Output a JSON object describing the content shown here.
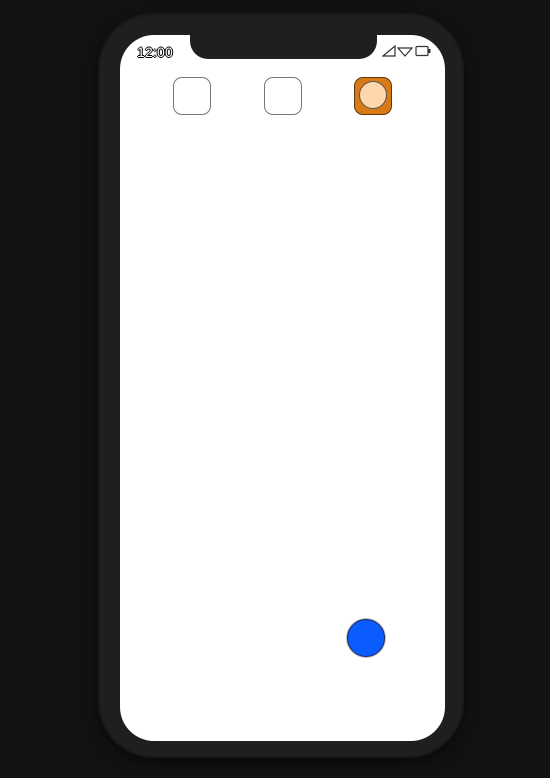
{
  "status_bar": {
    "time": "12:00",
    "icons": [
      "signal-icon",
      "wifi-icon",
      "battery-icon"
    ]
  },
  "app_icons": [
    {
      "name": "app-slot-1",
      "state": "empty"
    },
    {
      "name": "app-slot-2",
      "state": "empty"
    },
    {
      "name": "app-slot-3",
      "state": "selected"
    }
  ],
  "colors": {
    "background": "#121212",
    "phone_frame": "#1f1f1f",
    "screen": "#ffffff",
    "accent_orange": "#d97a16",
    "avatar_peach": "#ffd7ad",
    "fab_blue": "#0a5cff"
  },
  "fab": {
    "icon": "circle-button"
  }
}
